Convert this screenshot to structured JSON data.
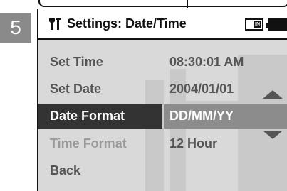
{
  "step": {
    "number": "5"
  },
  "header": {
    "title": "Settings: Date/Time",
    "title_icon": "settings-tools-icon",
    "memory_icon": "internal-memory-icon",
    "memory_label": "IN",
    "battery_icon": "battery-icon"
  },
  "menu": {
    "items": [
      {
        "label": "Set Time",
        "value": "08:30:01 AM"
      },
      {
        "label": "Set Date",
        "value": "2004/01/01"
      },
      {
        "label": "Date Format",
        "value": "DD/MM/YY"
      },
      {
        "label": "Time Format",
        "value": "12 Hour"
      },
      {
        "label": "Back",
        "value": ""
      }
    ],
    "selected_index": 2
  },
  "scroll": {
    "up_icon": "arrow-up-icon",
    "down_icon": "arrow-down-icon"
  },
  "colors": {
    "selected_label_bg": "#333333",
    "selected_value_bg": "#8c8c8c",
    "screen_bg": "#d9d9d9"
  }
}
